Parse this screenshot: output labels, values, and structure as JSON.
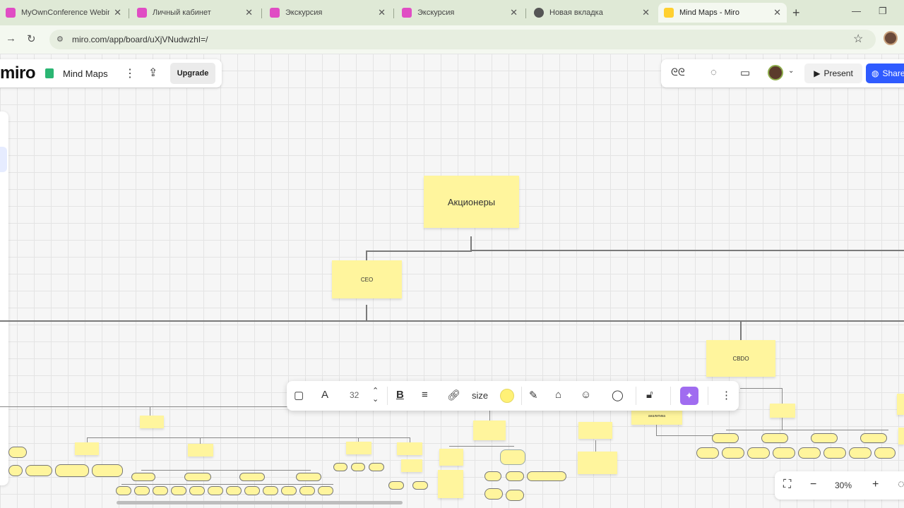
{
  "browser": {
    "tabs": [
      {
        "title": "MyOwnConference Webin",
        "favicon_color": "#e04dc4"
      },
      {
        "title": "Личный кабинет",
        "favicon_color": "#e04dc4"
      },
      {
        "title": "Экскурсия",
        "favicon_color": "#e04dc4"
      },
      {
        "title": "Экскурсия",
        "favicon_color": "#e04dc4"
      },
      {
        "title": "Новая вкладка",
        "favicon_color": "#555555"
      },
      {
        "title": "Mind Maps - Miro",
        "favicon_color": "#ffd02f",
        "active": true
      }
    ],
    "url": "miro.com/app/board/uXjVNudwzhI=/"
  },
  "miro": {
    "logo": "miro",
    "board_name": "Mind Maps",
    "upgrade_label": "Upgrade",
    "present_label": "Present",
    "share_label": "Share",
    "zoom": "30%",
    "accent_color": "#2f5bff"
  },
  "context_toolbar": {
    "font_size": "32",
    "size_label": "size",
    "color": "#fff176"
  },
  "mindmap": {
    "root": "Акционеры",
    "ceo": "CEO",
    "cbdo": "CBDO",
    "analytics": "аналитика"
  }
}
